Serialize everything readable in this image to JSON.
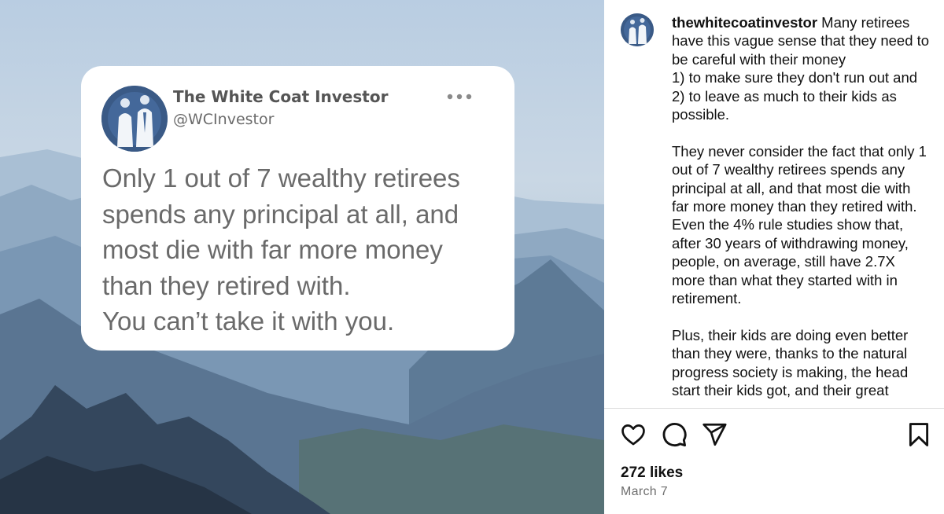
{
  "tweet": {
    "name": "The White Coat Investor",
    "handle": "@WCInvestor",
    "more_icon": "more-dots-icon",
    "line1": "Only 1 out of 7 wealthy retirees",
    "line2": "spends any principal at all, and",
    "line3": "most die with far more money",
    "line4": "than they retired with.",
    "line5": "You can’t take it with you."
  },
  "post": {
    "username": "thewhitecoatinvestor",
    "caption_p1": " Many retirees have this vague sense that they need to be careful with their money\n1) to make sure they don't run out and\n2) to leave as much to their kids as possible.",
    "caption_p2": "They never consider the fact that only 1 out of 7 wealthy retirees spends any principal at all, and that most die with far more money than they retired with. Even the 4% rule studies show that, after 30 years of withdrawing money, people, on average, still have 2.7X more than what they started with in retirement.",
    "caption_p3": "Plus, their kids are doing even better than they were, thanks to the natural progress society is making, the head start their kids got, and their great",
    "likes": "272 likes",
    "date": "March 7"
  },
  "icons": {
    "like": "heart-icon",
    "comment": "comment-icon",
    "share": "send-icon",
    "save": "bookmark-icon"
  },
  "colors": {
    "avatar_bg": "#3a5a86",
    "tweet_text": "#6a6a6a"
  }
}
